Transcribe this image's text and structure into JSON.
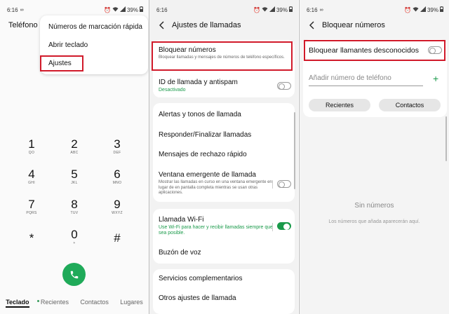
{
  "status_bar": {
    "time": "6:16",
    "battery": "39%"
  },
  "panel1": {
    "title": "Teléfono",
    "menu": {
      "items": [
        "Números de marcación rápida",
        "Abrir teclado",
        "Ajustes"
      ]
    },
    "keypad": [
      {
        "digit": "1",
        "letters": "QO"
      },
      {
        "digit": "2",
        "letters": "ABC"
      },
      {
        "digit": "3",
        "letters": "DEF"
      },
      {
        "digit": "4",
        "letters": "GHI"
      },
      {
        "digit": "5",
        "letters": "JKL"
      },
      {
        "digit": "6",
        "letters": "MNO"
      },
      {
        "digit": "7",
        "letters": "PQRS"
      },
      {
        "digit": "8",
        "letters": "TUV"
      },
      {
        "digit": "9",
        "letters": "WXYZ"
      },
      {
        "digit": "*",
        "letters": ""
      },
      {
        "digit": "0",
        "letters": "+"
      },
      {
        "digit": "#",
        "letters": ""
      }
    ],
    "tabs": [
      "Teclado",
      "Recientes",
      "Contactos",
      "Lugares"
    ]
  },
  "panel2": {
    "title": "Ajustes de llamadas",
    "block": {
      "label": "Bloquear números",
      "desc": "Bloquear llamadas y mensajes de números de teléfono específicos."
    },
    "caller_id": {
      "label": "ID de llamada y antispam",
      "status": "Desactivado"
    },
    "alerts": "Alertas y tonos de llamada",
    "answer": "Responder/Finalizar llamadas",
    "reject": "Mensajes de rechazo rápido",
    "popup": {
      "label": "Ventana emergente de llamada",
      "desc": "Mostrar las llamadas en curso en una ventana emergente en lugar de en pantalla completa mientras se usan otras aplicaciones."
    },
    "wifi": {
      "label": "Llamada Wi-Fi",
      "desc": "Use Wi-Fi para hacer y recibir llamadas siempre que sea posible."
    },
    "voicemail": "Buzón de voz",
    "extra": "Servicios complementarios",
    "other": "Otros ajustes de llamada"
  },
  "panel3": {
    "title": "Bloquear números",
    "unknown_label": "Bloquear llamantes desconocidos",
    "add_placeholder": "Añadir número de teléfono",
    "recent_button": "Recientes",
    "contacts_button": "Contactos",
    "empty_title": "Sin números",
    "empty_sub": "Los números que añada aparecerán aquí."
  },
  "colors": {
    "accent": "#1a9a4a",
    "highlight": "#d11a2a",
    "call_button": "#1faa59"
  },
  "toggles": {
    "caller_id_on": false,
    "popup_on": false,
    "wifi_on": true,
    "unknown_on": false
  }
}
